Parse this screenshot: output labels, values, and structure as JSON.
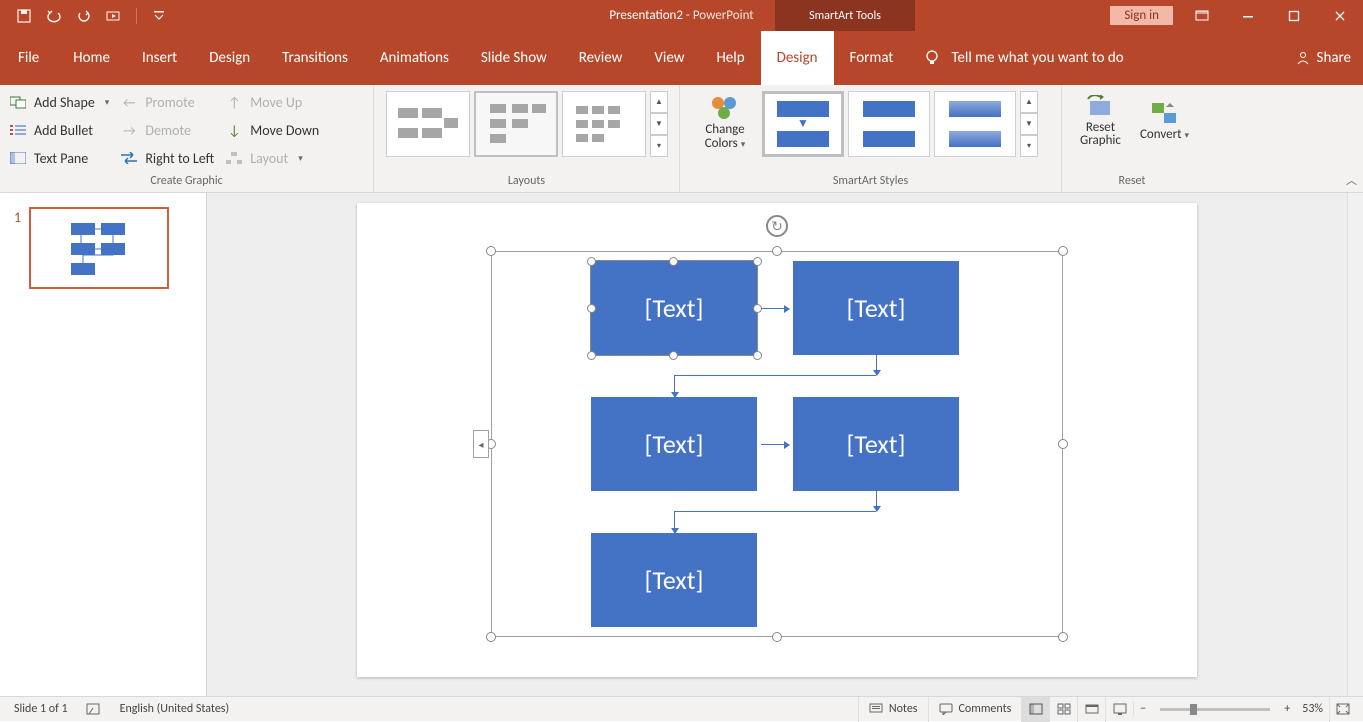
{
  "titlebar": {
    "doc_title": "Presentation2",
    "app_suffix": "  -  PowerPoint",
    "context_label": "SmartArt Tools",
    "signin": "Sign in"
  },
  "tabs": {
    "file": "File",
    "home": "Home",
    "insert": "Insert",
    "design": "Design",
    "transitions": "Transitions",
    "animations": "Animations",
    "slideshow": "Slide Show",
    "review": "Review",
    "view": "View",
    "help": "Help",
    "sa_design": "Design",
    "sa_format": "Format",
    "tellme": "Tell me what you want to do",
    "share": "Share"
  },
  "ribbon": {
    "create_graphic": {
      "label": "Create Graphic",
      "add_shape": "Add Shape",
      "add_bullet": "Add Bullet",
      "text_pane": "Text Pane",
      "promote": "Promote",
      "demote": "Demote",
      "right_to_left": "Right to Left",
      "move_up": "Move Up",
      "move_down": "Move Down",
      "layout": "Layout"
    },
    "layouts_label": "Layouts",
    "styles_label": "SmartArt Styles",
    "change_colors": "Change Colors",
    "reset_label": "Reset",
    "reset_graphic": "Reset Graphic",
    "convert": "Convert"
  },
  "slide_panel": {
    "slide_number": "1"
  },
  "smartart": {
    "boxes": [
      "[Text]",
      "[Text]",
      "[Text]",
      "[Text]",
      "[Text]"
    ]
  },
  "statusbar": {
    "slide_info": "Slide 1 of 1",
    "language": "English (United States)",
    "notes": "Notes",
    "comments": "Comments",
    "zoom_pct": "53%"
  }
}
